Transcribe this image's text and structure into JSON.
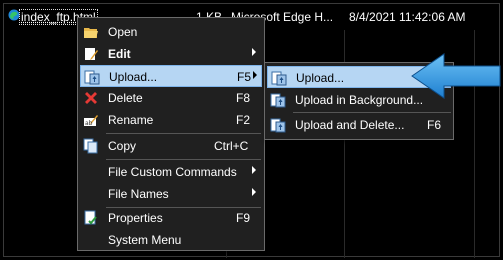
{
  "file_row": {
    "name": "index_ftp.html",
    "size": "1 KB",
    "type": "Microsoft Edge H...",
    "modified": "8/4/2021 11:42:06 AM"
  },
  "context_menu": {
    "items": [
      {
        "label": "Open",
        "shortcut": "",
        "icon": "folder-open-icon",
        "submenu": false
      },
      {
        "label": "Edit",
        "shortcut": "",
        "icon": "edit-icon",
        "submenu": true,
        "bold": true
      },
      {
        "label": "Upload...",
        "shortcut": "F5",
        "icon": "upload-icon",
        "submenu": true,
        "highlighted": true
      },
      {
        "label": "Delete",
        "shortcut": "F8",
        "icon": "delete-icon",
        "submenu": false
      },
      {
        "label": "Rename",
        "shortcut": "F2",
        "icon": "rename-icon",
        "submenu": false
      },
      {
        "label": "Copy",
        "shortcut": "Ctrl+C",
        "icon": "copy-icon",
        "submenu": false
      },
      {
        "label": "File Custom Commands",
        "shortcut": "",
        "icon": "",
        "submenu": true
      },
      {
        "label": "File Names",
        "shortcut": "",
        "icon": "",
        "submenu": true
      },
      {
        "label": "Properties",
        "shortcut": "F9",
        "icon": "properties-icon",
        "submenu": false
      },
      {
        "label": "System Menu",
        "shortcut": "",
        "icon": "",
        "submenu": false
      }
    ]
  },
  "submenu": {
    "items": [
      {
        "label": "Upload...",
        "shortcut": "",
        "icon": "upload-icon",
        "highlighted": true
      },
      {
        "label": "Upload in Background...",
        "shortcut": "",
        "icon": "upload-background-icon"
      },
      {
        "label": "Upload and Delete...",
        "shortcut": "F6",
        "icon": "upload-delete-icon"
      }
    ]
  },
  "colors": {
    "highlight": "#b6d6f3",
    "menu_background": "#202020",
    "arrow": "#3aa0e8"
  }
}
